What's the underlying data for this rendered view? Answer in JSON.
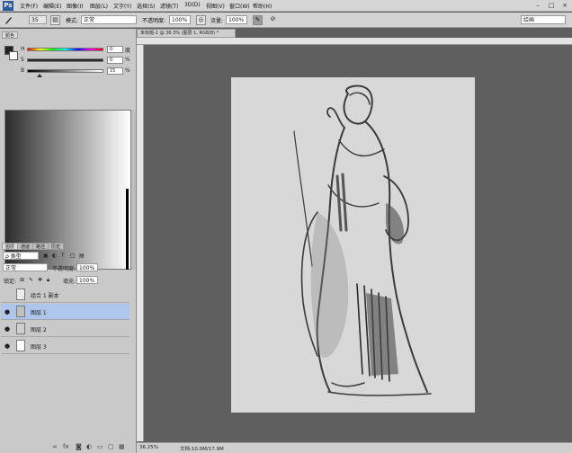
{
  "app": {
    "logo": "Ps"
  },
  "menu": [
    "文件(F)",
    "编辑(E)",
    "图像(I)",
    "图层(L)",
    "文字(Y)",
    "选择(S)",
    "滤镜(T)",
    "3D(D)",
    "视图(V)",
    "窗口(W)",
    "帮助(H)"
  ],
  "window_controls": {
    "minimize": "–",
    "maximize": "□",
    "close": "×"
  },
  "options": {
    "brush_size": "35",
    "mode_label": "模式:",
    "mode_value": "正常",
    "opacity_label": "不透明度:",
    "opacity_value": "100%",
    "flow_label": "流量:",
    "flow_value": "100%",
    "workspace_value": "绘画"
  },
  "color_panel": {
    "tab_label": "颜色",
    "sliders": [
      {
        "label": "H",
        "value": "0",
        "unit": "度"
      },
      {
        "label": "S",
        "value": "0",
        "unit": "%"
      },
      {
        "label": "B",
        "value": "15",
        "unit": "%"
      }
    ]
  },
  "layers_panel": {
    "tabs": [
      "图层",
      "通道",
      "路径",
      "历史"
    ],
    "kind_label": "ρ 类型",
    "blend_mode": "正常",
    "opacity_label": "不透明度:",
    "opacity_value": "100%",
    "lock_label": "锁定:",
    "fill_label": "填充:",
    "fill_value": "100%",
    "layers": [
      {
        "name": "组合 1 副本",
        "visible": false,
        "selected": false
      },
      {
        "name": "图层 1",
        "visible": true,
        "selected": true
      },
      {
        "name": "图层 2",
        "visible": true,
        "selected": false
      },
      {
        "name": "图层 3",
        "visible": true,
        "selected": false
      }
    ]
  },
  "document": {
    "tab_title": "未标题-1 @ 36.3% (图层 1, RGB/8) *",
    "zoom": "36.25%",
    "doc_info": "文档:10.0M/17.9M"
  },
  "colors": {
    "panel_bg": "#c9c9c9",
    "canvas_bg": "#5f5f5f",
    "artboard": "#d8d8d8",
    "selection": "#aec6ec"
  },
  "icons": [
    "brush-icon",
    "eye-icon",
    "link-icon",
    "fx-icon",
    "mask-icon",
    "adjustment-icon",
    "folder-icon",
    "new-layer-icon",
    "trash-icon"
  ]
}
